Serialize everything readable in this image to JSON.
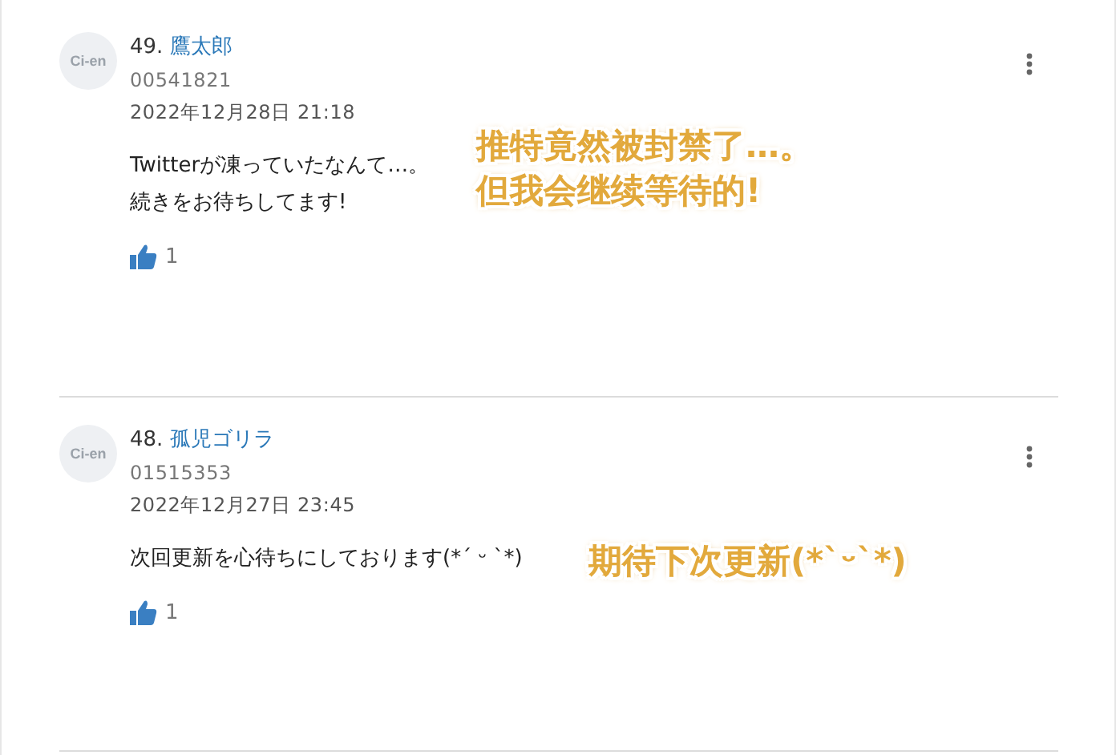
{
  "comments": [
    {
      "avatar": "Ci-en",
      "number": "49.",
      "author": "鷹太郎",
      "user_id": "00541821",
      "date": "2022年12月28日 21:18",
      "lines": [
        "Twitterが凍っていたなんて…。",
        "続きをお待ちしてます!"
      ],
      "likes": "1",
      "translation": [
        "推特竟然被封禁了…。",
        "但我会继续等待的!"
      ]
    },
    {
      "avatar": "Ci-en",
      "number": "48.",
      "author": "孤児ゴリラ",
      "user_id": "01515353",
      "date": "2022年12月27日 23:45",
      "lines": [
        "次回更新を心待ちにしております(*´ ᵕ `*)"
      ],
      "likes": "1",
      "translation": [
        "期待下次更新(*`ᵕ`*)"
      ]
    }
  ]
}
